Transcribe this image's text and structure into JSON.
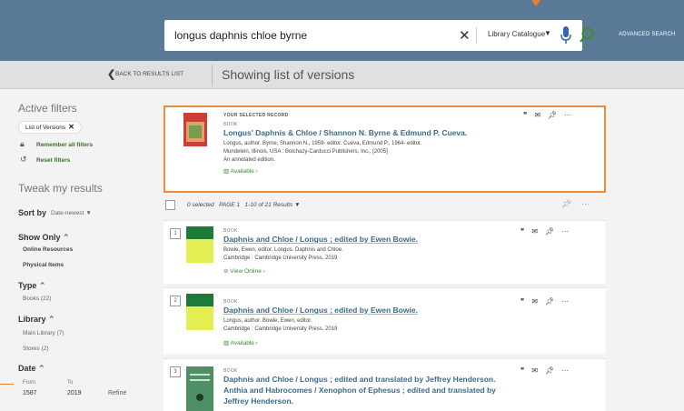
{
  "header": {
    "search_query": "longus daphnis chloe byrne",
    "clear_symbol": "✕",
    "scope": "Library Catalogue",
    "advanced_search": "ADVANCED SEARCH"
  },
  "subheader": {
    "back_label": "BACK TO RESULTS LIST",
    "title": "Showing list of versions"
  },
  "sidebar": {
    "active_filters": "Active filters",
    "chip": "List of Versions",
    "remember": "Remember all filters",
    "reset": "Reset filters",
    "tweak": "Tweak my results",
    "sort_label": "Sort by",
    "sort_value": "Date-newest",
    "show_only": "Show Only",
    "show_only_items": [
      "Online Resources",
      "Physical Items"
    ],
    "type": "Type",
    "type_items": [
      "Books (22)"
    ],
    "library": "Library",
    "library_items": [
      "Main Library (7)",
      "Stores (2)"
    ],
    "date": "Date",
    "date_from_label": "From",
    "date_to_label": "To",
    "date_from": "1587",
    "date_to": "2019",
    "refine": "Refine"
  },
  "selected_record": {
    "kicker": "YOUR SELECTED RECORD",
    "type": "BOOK",
    "title": "Longus' Daphnis & Chloe / Shannon N. Byrne & Edmund P. Cueva.",
    "line1": "Longus, author. Byrne, Shannon N., 1959- editor. Cueva, Edmund P., 1964- editor.",
    "line2": "Mundelein, Illinois, USA : Bolchazy-Carducci Publishers, Inc., [2005]",
    "line3": "An annotated edition.",
    "availability": "Available"
  },
  "results_bar": {
    "selected": "0 selected",
    "page": "PAGE 1",
    "range": "1-10 of 21 Results"
  },
  "results": [
    {
      "num": "1",
      "type": "BOOK",
      "title": "Daphnis and Chloe / Longus ; edited by Ewen Bowie.",
      "line1": "Bowie, Ewen, editor. Longus. Daphnis and Chloe.",
      "line2": "Cambridge : Cambridge University Press, 2019",
      "link": "View Online"
    },
    {
      "num": "2",
      "type": "BOOK",
      "title": "Daphnis and Chloe / Longus ; edited by Ewen Bowie.",
      "line1": "Longus, author. Bowie, Ewen, editor.",
      "line2": "Cambridge : Cambridge University Press, 2019",
      "link": "Available"
    },
    {
      "num": "3",
      "type": "BOOK",
      "title_l1": "Daphnis and Chloe / Longus ; edited and translated by Jeffrey Henderson.",
      "title_l2": "Anthia and Habrocomes / Xenophon of Ephesus ; edited and translated by",
      "title_l3": "Jeffrey Henderson."
    }
  ],
  "colors": {
    "header": "#5a7996",
    "accent_orange": "#ec8b3a",
    "link_blue": "#3c6b8a",
    "green": "#3b8a2f"
  }
}
